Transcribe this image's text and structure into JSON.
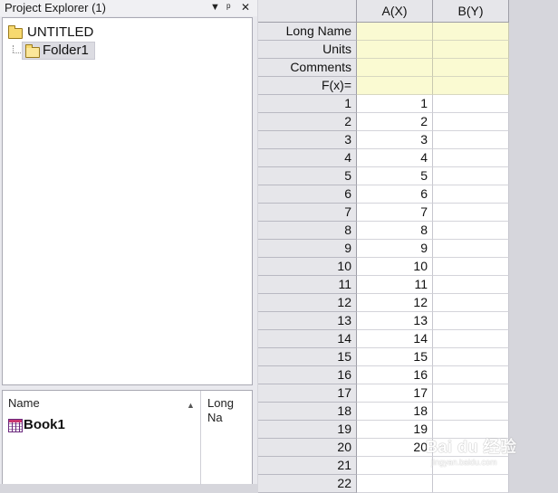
{
  "project_explorer": {
    "title": "Project Explorer (1)",
    "controls": {
      "dropdown": "▼",
      "pin": "ᵖ",
      "close": "✕"
    },
    "tree": {
      "root": "UNTITLED",
      "child": "Folder1"
    },
    "list": {
      "columns": [
        "Name",
        "Long Na"
      ],
      "sort_indicator": "▲",
      "items": [
        {
          "name": "Book1"
        }
      ]
    }
  },
  "worksheet": {
    "columns": [
      "A(X)",
      "B(Y)"
    ],
    "meta_rows": [
      "Long Name",
      "Units",
      "Comments",
      "F(x)="
    ],
    "rows": [
      {
        "n": "1",
        "a": "1"
      },
      {
        "n": "2",
        "a": "2"
      },
      {
        "n": "3",
        "a": "3"
      },
      {
        "n": "4",
        "a": "4"
      },
      {
        "n": "5",
        "a": "5"
      },
      {
        "n": "6",
        "a": "6"
      },
      {
        "n": "7",
        "a": "7"
      },
      {
        "n": "8",
        "a": "8"
      },
      {
        "n": "9",
        "a": "9"
      },
      {
        "n": "10",
        "a": "10"
      },
      {
        "n": "11",
        "a": "11"
      },
      {
        "n": "12",
        "a": "12"
      },
      {
        "n": "13",
        "a": "13"
      },
      {
        "n": "14",
        "a": "14"
      },
      {
        "n": "15",
        "a": "15"
      },
      {
        "n": "16",
        "a": "16"
      },
      {
        "n": "17",
        "a": "17"
      },
      {
        "n": "18",
        "a": "18"
      },
      {
        "n": "19",
        "a": "19"
      },
      {
        "n": "20",
        "a": "20"
      },
      {
        "n": "21",
        "a": ""
      },
      {
        "n": "22",
        "a": ""
      }
    ]
  },
  "watermark": {
    "main": "Bai du 经验",
    "sub": "jingyan.baidu.com"
  },
  "colors": {
    "meta_bg": "#fafad2",
    "header_bg": "#e6e6ea",
    "panel_bg": "#e9e9ee"
  }
}
